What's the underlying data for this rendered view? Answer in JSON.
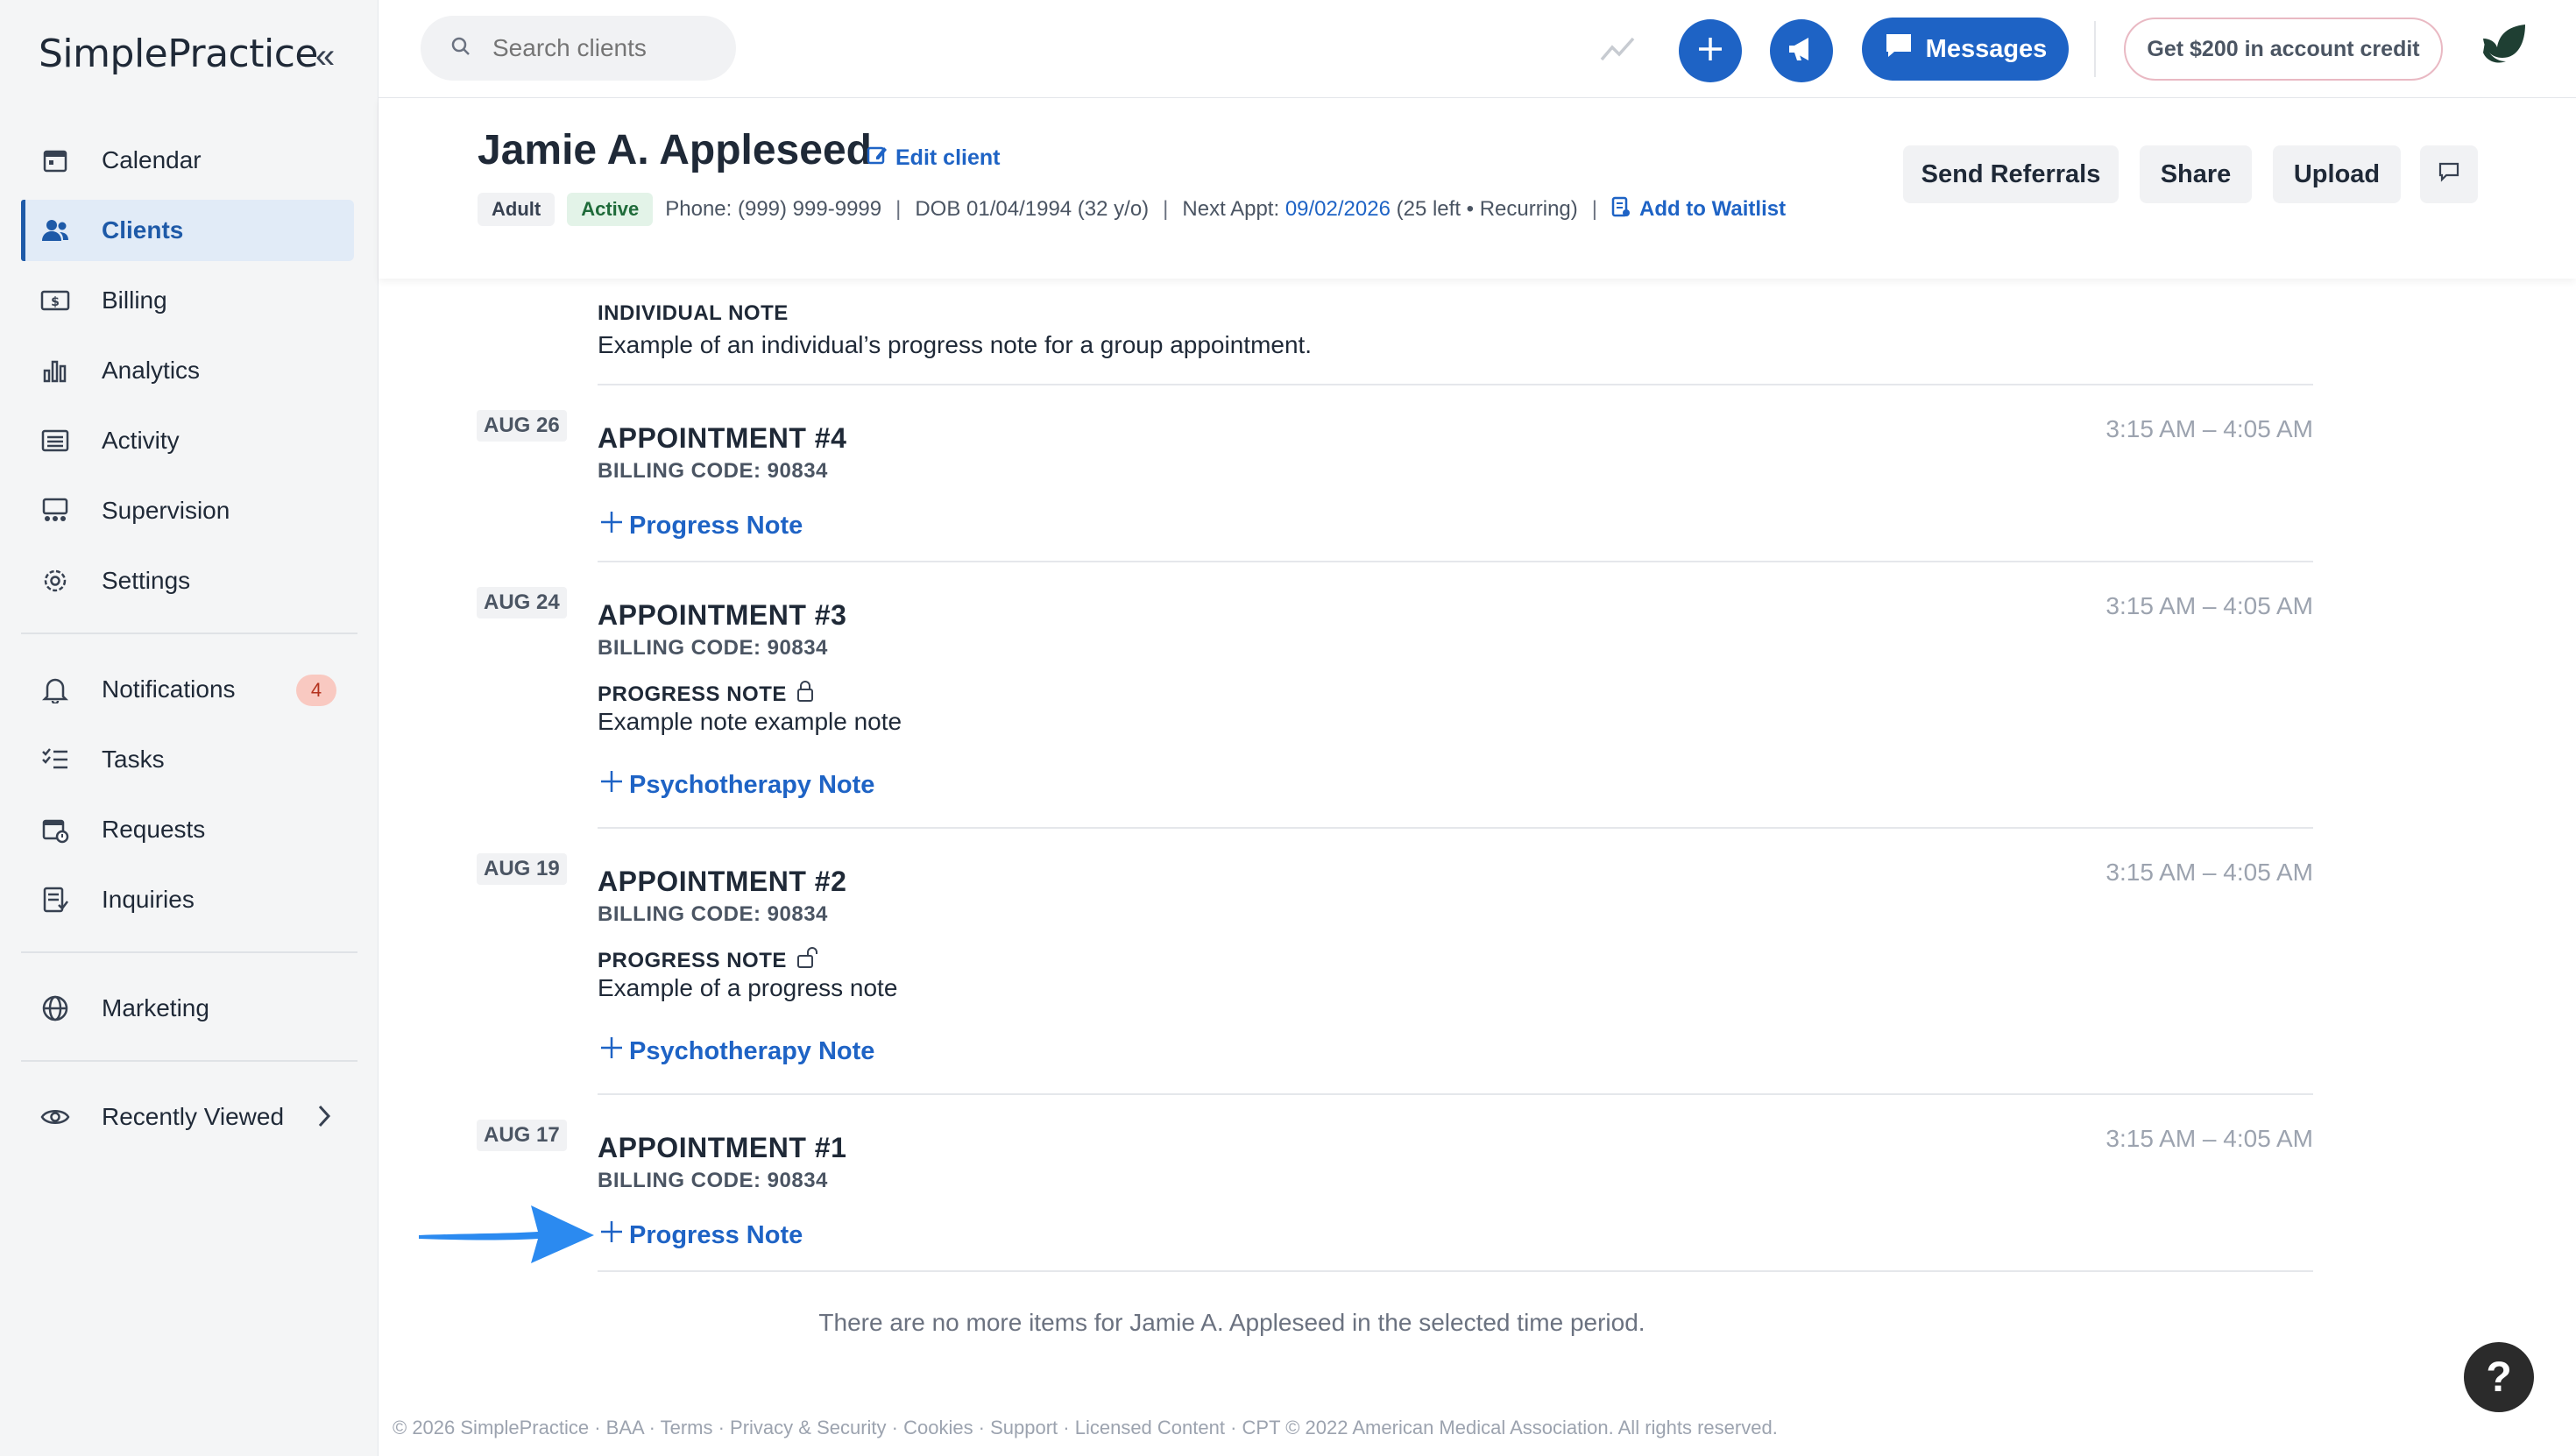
{
  "brand": {
    "name": "SimplePractice"
  },
  "sidebar": {
    "collapse_label": "«",
    "items": [
      {
        "label": "Calendar",
        "icon": "calendar-icon"
      },
      {
        "label": "Clients",
        "icon": "users-icon"
      },
      {
        "label": "Billing",
        "icon": "billing-icon"
      },
      {
        "label": "Analytics",
        "icon": "analytics-icon"
      },
      {
        "label": "Activity",
        "icon": "activity-icon"
      },
      {
        "label": "Supervision",
        "icon": "supervision-icon"
      },
      {
        "label": "Settings",
        "icon": "gear-icon"
      }
    ],
    "items2": [
      {
        "label": "Notifications",
        "icon": "bell-icon",
        "badge": "4"
      },
      {
        "label": "Tasks",
        "icon": "tasks-icon"
      },
      {
        "label": "Requests",
        "icon": "requests-icon"
      },
      {
        "label": "Inquiries",
        "icon": "inquiries-icon"
      }
    ],
    "items3": [
      {
        "label": "Marketing",
        "icon": "globe-icon"
      }
    ],
    "items4": [
      {
        "label": "Recently Viewed",
        "icon": "eye-icon"
      }
    ]
  },
  "topbar": {
    "search_placeholder": "Search clients",
    "messages_label": "Messages",
    "credit_label": "Get $200 in account credit"
  },
  "client": {
    "name": "Jamie A. Appleseed",
    "edit_label": "Edit client",
    "tags": [
      "Adult",
      "Active"
    ],
    "phone": "Phone: (999) 999-9999",
    "dob": "DOB 01/04/1994 (32 y/o)",
    "next_appt_label": "Next Appt:",
    "next_appt_date": "09/02/2026",
    "next_appt_extra": "(25 left • Recurring)",
    "waitlist_label": "Add to Waitlist",
    "actions": [
      "Send Referrals",
      "Share",
      "Upload"
    ]
  },
  "timeline": {
    "partial_entry": {
      "note_label": "INDIVIDUAL NOTE",
      "note_text": "Example of an individual’s progress note for a group appointment."
    },
    "entries": [
      {
        "date": "AUG 26",
        "title": "APPOINTMENT #4",
        "billing": "BILLING CODE: 90834",
        "time": "3:15 AM – 4:05 AM",
        "add_label": "Progress Note"
      },
      {
        "date": "AUG 24",
        "title": "APPOINTMENT #3",
        "billing": "BILLING CODE: 90834",
        "time": "3:15 AM – 4:05 AM",
        "note_label": "PROGRESS NOTE",
        "note_text": "Example note example note",
        "add_label": "Psychotherapy Note"
      },
      {
        "date": "AUG 19",
        "title": "APPOINTMENT #2",
        "billing": "BILLING CODE: 90834",
        "time": "3:15 AM – 4:05 AM",
        "note_label": "PROGRESS NOTE",
        "note_text": "Example of a progress note",
        "add_label": "Psychotherapy Note"
      },
      {
        "date": "AUG 17",
        "title": "APPOINTMENT #1",
        "billing": "BILLING CODE: 90834",
        "time": "3:15 AM – 4:05 AM",
        "add_label": "Progress Note"
      }
    ],
    "end_message": "There are no more items for Jamie A. Appleseed in the selected time period."
  },
  "footer": {
    "text": "© 2026 SimplePractice · BAA · Terms · Privacy & Security · Cookies · Support · Licensed Content · CPT © 2022 American Medical Association. All rights reserved."
  },
  "help_label": "?"
}
